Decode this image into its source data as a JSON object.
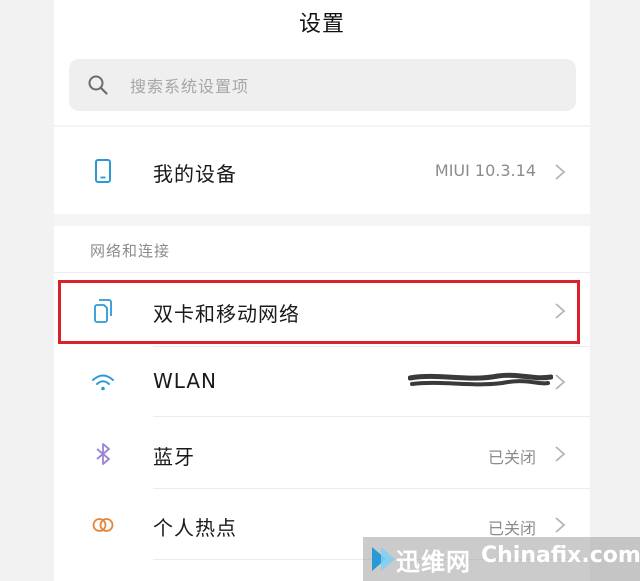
{
  "header": {
    "title": "设置"
  },
  "search": {
    "placeholder": "搜索系统设置项"
  },
  "device_row": {
    "label": "我的设备",
    "value": "MIUI 10.3.14"
  },
  "network_section": {
    "heading": "网络和连接",
    "items": [
      {
        "label": "双卡和移动网络",
        "value": ""
      },
      {
        "label": "WLAN",
        "value": ""
      },
      {
        "label": "蓝牙",
        "value": "已关闭"
      },
      {
        "label": "个人热点",
        "value": "已关闭"
      }
    ]
  },
  "watermark": {
    "cn": "迅维网",
    "en": "Chinafix.com"
  },
  "colors": {
    "accent_icon": "#2a9ad6",
    "highlight_border": "#d8222b",
    "secondary_text": "#8c8c8c"
  },
  "icons": {
    "search": "search-icon",
    "device": "phone-icon",
    "sim": "dual-sim-icon",
    "wlan": "wifi-icon",
    "bluetooth": "bluetooth-icon",
    "hotspot": "hotspot-icon",
    "chevron": "chevron-right-icon"
  }
}
